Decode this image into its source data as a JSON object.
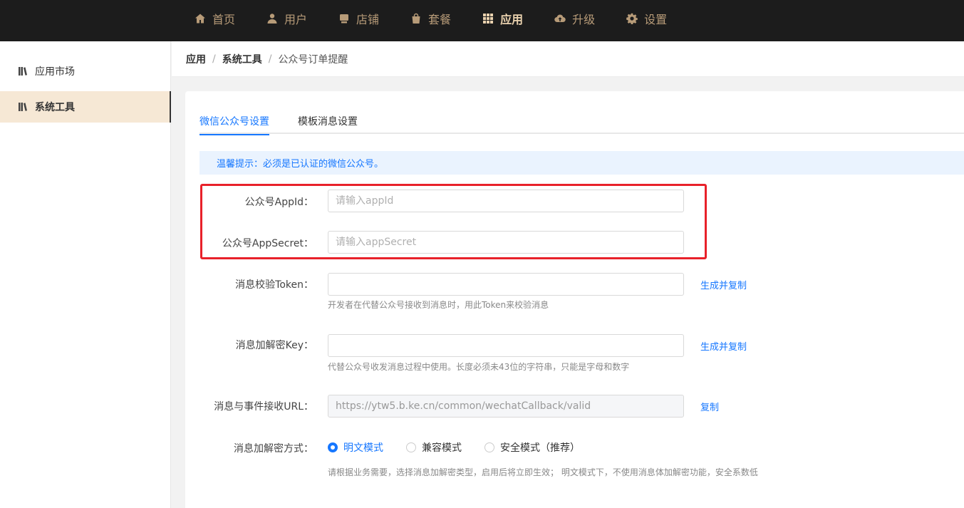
{
  "nav": {
    "items": [
      {
        "label": "首页",
        "icon": "home-icon"
      },
      {
        "label": "用户",
        "icon": "user-icon"
      },
      {
        "label": "店铺",
        "icon": "store-icon"
      },
      {
        "label": "套餐",
        "icon": "bag-icon"
      },
      {
        "label": "应用",
        "icon": "apps-grid-icon",
        "active": true
      },
      {
        "label": "升级",
        "icon": "cloud-upload-icon"
      },
      {
        "label": "设置",
        "icon": "gear-icon"
      }
    ]
  },
  "sidebar": {
    "items": [
      {
        "label": "应用市场",
        "icon": "book-icon"
      },
      {
        "label": "系统工具",
        "icon": "book-icon",
        "active": true
      }
    ]
  },
  "breadcrumb": {
    "items": [
      "应用",
      "系统工具",
      "公众号订单提醒"
    ],
    "separator": "/"
  },
  "tabs": {
    "items": [
      "微信公众号设置",
      "模板消息设置"
    ],
    "active_index": 0
  },
  "alert": {
    "text": "温馨提示：必须是已认证的微信公众号。"
  },
  "form": {
    "appid": {
      "label": "公众号AppId：",
      "placeholder": "请输入appId",
      "value": ""
    },
    "appsecret": {
      "label": "公众号AppSecret：",
      "placeholder": "请输入appSecret",
      "value": ""
    },
    "token": {
      "label": "消息校验Token：",
      "value": "",
      "action": "生成并复制",
      "hint": "开发者在代替公众号接收到消息时，用此Token来校验消息"
    },
    "aeskey": {
      "label": "消息加解密Key：",
      "value": "",
      "action": "生成并复制",
      "hint": "代替公众号收发消息过程中使用。长度必须未43位的字符串，只能是字母和数字"
    },
    "url": {
      "label": "消息与事件接收URL：",
      "value": "https://ytw5.b.ke.cn/common/wechatCallback/valid",
      "action": "复制"
    },
    "encrypt_mode": {
      "label": "消息加解密方式：",
      "options": [
        "明文模式",
        "兼容模式",
        "安全模式（推荐）"
      ],
      "selected_index": 0,
      "hint": "请根据业务需要，选择消息加解密类型，启用后将立即生效； 明文模式下，不使用消息体加解密功能，安全系数低"
    }
  },
  "colors": {
    "topbar_bg": "#1c1c1c",
    "nav_text": "#b79b78",
    "nav_active": "#e9d1ae",
    "primary": "#1677ff",
    "highlight_border": "#e8212a",
    "sidebar_active_bg": "#f6e8d5"
  }
}
